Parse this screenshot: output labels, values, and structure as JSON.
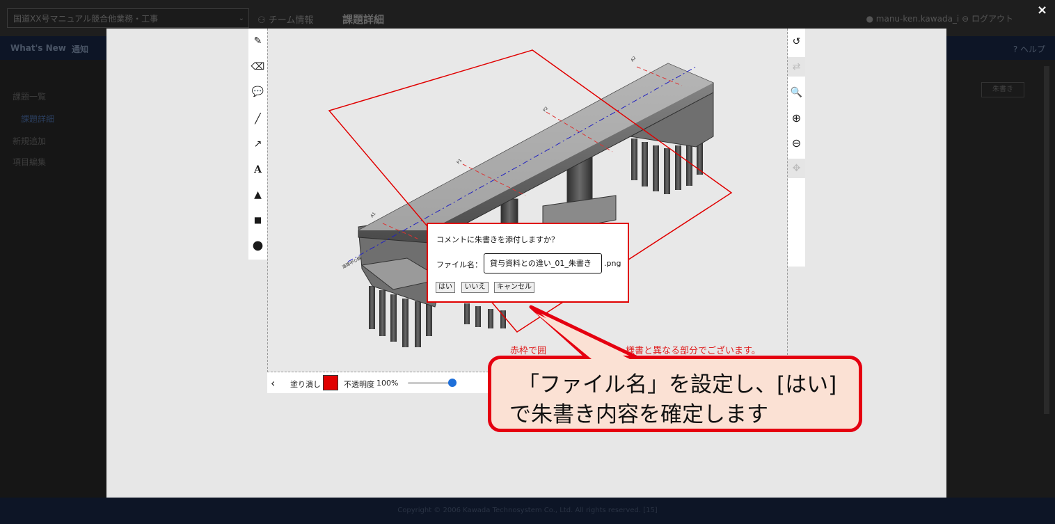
{
  "app": {
    "project_select": "国道XX号マニュアル競合他業務・工事",
    "team_info": "チーム情報",
    "page_title": "課題詳細",
    "user": "manu-ken.kawada_i",
    "logout": "ログアウト",
    "nav": [
      "What's New",
      "通知"
    ],
    "help": "? ヘルプ",
    "sidebar": [
      "課題一覧",
      "課題詳細",
      "新規追加",
      "項目編集"
    ],
    "right_button": "朱書き",
    "footer": "Copyright © 2006 Kawada Technosystem Co., Ltd. All rights reserved. [15]",
    "close": "×"
  },
  "editor": {
    "left_tools": [
      {
        "icon": "pencil-icon",
        "glyph": "✎"
      },
      {
        "icon": "eraser-icon",
        "glyph": "⌫"
      },
      {
        "icon": "comment-icon",
        "glyph": "💬"
      },
      {
        "icon": "line-icon",
        "glyph": "╱"
      },
      {
        "icon": "arrow-icon",
        "glyph": "↗"
      },
      {
        "icon": "text-icon",
        "glyph": "A"
      },
      {
        "icon": "triangle-icon",
        "glyph": "▲"
      },
      {
        "icon": "square-icon",
        "glyph": "■"
      },
      {
        "icon": "circle-icon",
        "glyph": "●"
      }
    ],
    "right_tools": [
      {
        "icon": "undo-icon",
        "glyph": "↺",
        "disabled": false
      },
      {
        "icon": "redo-icon",
        "glyph": "⇄",
        "disabled": true
      },
      {
        "icon": "search-icon",
        "glyph": "🔍",
        "disabled": false
      },
      {
        "icon": "zoom-in-icon",
        "glyph": "⊕",
        "disabled": false
      },
      {
        "icon": "zoom-out-icon",
        "glyph": "⊖",
        "disabled": false
      },
      {
        "icon": "move-icon",
        "glyph": "✥",
        "disabled": true
      }
    ],
    "fill_label": "塗り潰し",
    "fill_color": "#e00000",
    "opacity_label": "不透明度",
    "opacity_value": "100%",
    "canvas_note": "赤枠で囲",
    "canvas_note_tail": "様書と異なる部分でございます。",
    "drawing_labels": [
      "A1",
      "P1",
      "P2",
      "A2",
      "道路中心線"
    ]
  },
  "dialog": {
    "question": "コメントに朱書きを添付しますか？",
    "filename_label": "ファイル名：",
    "filename_value": "貸与資料との違い_01_朱書き",
    "extension": ".png",
    "buttons": {
      "yes": "はい",
      "no": "いいえ",
      "cancel": "キャンセル"
    }
  },
  "callout": {
    "line1": "「ファイル名」を設定し、[はい]",
    "line2": "で朱書き内容を確定します"
  }
}
